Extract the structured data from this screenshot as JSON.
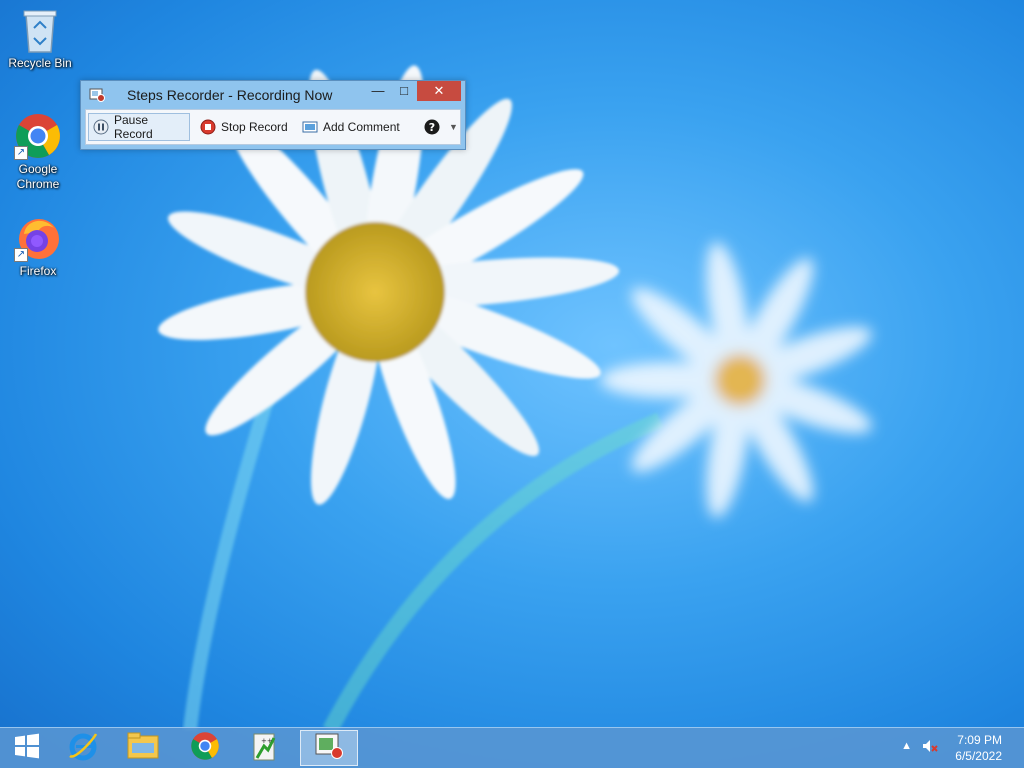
{
  "desktop": {
    "icons": [
      {
        "label": "Recycle Bin",
        "icon": "recycle-bin-icon"
      },
      {
        "label": "Google Chrome",
        "icon": "chrome-icon"
      },
      {
        "label": "Firefox",
        "icon": "firefox-icon"
      }
    ]
  },
  "steps_recorder": {
    "title": "Steps Recorder - Recording Now",
    "pause_label": "Pause Record",
    "stop_label": "Stop Record",
    "comment_label": "Add Comment",
    "help_icon": "help-icon",
    "minimize_glyph": "—",
    "maximize_glyph": "□",
    "close_glyph": "✕"
  },
  "taskbar": {
    "items": [
      {
        "icon": "windows-start-icon"
      },
      {
        "icon": "internet-explorer-icon"
      },
      {
        "icon": "file-explorer-icon"
      },
      {
        "icon": "chrome-icon"
      },
      {
        "icon": "notepad-plus-plus-icon"
      },
      {
        "icon": "steps-recorder-icon",
        "active": true
      }
    ],
    "clock_time": "7:09 PM",
    "clock_date": "6/5/2022",
    "tray_icons": [
      "show-hidden-icons-icon",
      "speaker-muted-icon"
    ]
  },
  "colors": {
    "close_button": "#c74b40",
    "window_frame": "#8fc4ee",
    "taskbar": "#5a96d2"
  }
}
